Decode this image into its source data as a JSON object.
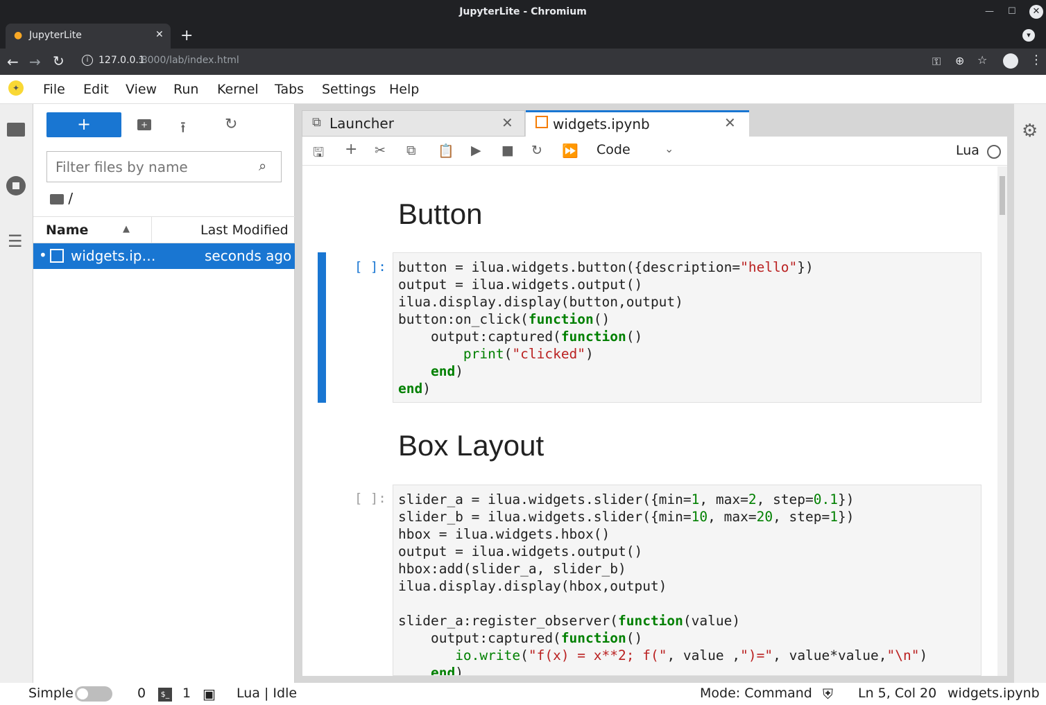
{
  "window": {
    "title": "JupyterLite - Chromium"
  },
  "browser": {
    "tab_title": "JupyterLite",
    "new_tab": "+",
    "url_host": "127.0.0.1",
    "url_rest": ":8000/lab/index.html"
  },
  "menu": [
    "File",
    "Edit",
    "View",
    "Run",
    "Kernel",
    "Tabs",
    "Settings",
    "Help"
  ],
  "filebrowser": {
    "new_label": "+",
    "filter_placeholder": "Filter files by name",
    "breadcrumb": "/",
    "col_name": "Name",
    "col_modified": "Last Modified",
    "files": [
      {
        "name": "widgets.ip…",
        "modified": "seconds ago",
        "dot": "•"
      }
    ]
  },
  "tabs": [
    {
      "label": "Launcher"
    },
    {
      "label": "widgets.ipynb"
    }
  ],
  "notebook": {
    "cell_type": "Code",
    "kernel": "Lua",
    "heading1": "Button",
    "prompt1": "[ ]:",
    "heading2": "Box Layout",
    "prompt2": "[ ]:"
  },
  "status": {
    "mode_label": "Simple",
    "terminals": "0",
    "kernels": "1",
    "kernel_status": "Lua | Idle",
    "mode": "Mode: Command",
    "cursor": "Ln 5, Col 20",
    "file": "widgets.ipynb"
  },
  "colors": {
    "accent": "#1976d2",
    "keyword": "#008000",
    "string": "#ba2121"
  }
}
